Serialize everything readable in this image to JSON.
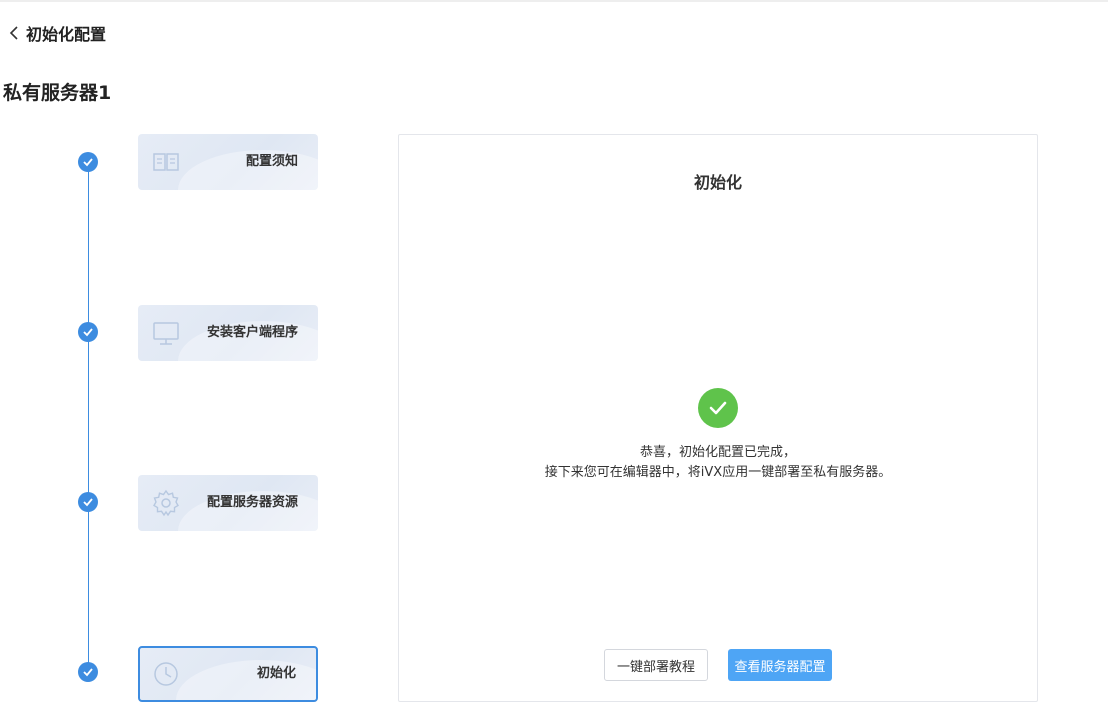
{
  "header": {
    "back_label": "初始化配置"
  },
  "page": {
    "title": "私有服务器1"
  },
  "steps": [
    {
      "label": "配置须知",
      "icon": "book-icon",
      "completed": true
    },
    {
      "label": "安装客户端程序",
      "icon": "monitor-icon",
      "completed": true
    },
    {
      "label": "配置服务器资源",
      "icon": "gear-icon",
      "completed": true
    },
    {
      "label": "初始化",
      "icon": "clock-icon",
      "completed": true,
      "active": true
    }
  ],
  "panel": {
    "title": "初始化",
    "message_line1": "恭喜，初始化配置已完成，",
    "message_line2": "接下来您可在编辑器中，将iVX应用一键部署至私有服务器。",
    "buttons": {
      "tutorial": "一键部署教程",
      "view_config": "查看服务器配置"
    }
  },
  "colors": {
    "accent": "#3d8ce0",
    "success": "#5fc34b",
    "primary_button": "#4ea5f5"
  }
}
